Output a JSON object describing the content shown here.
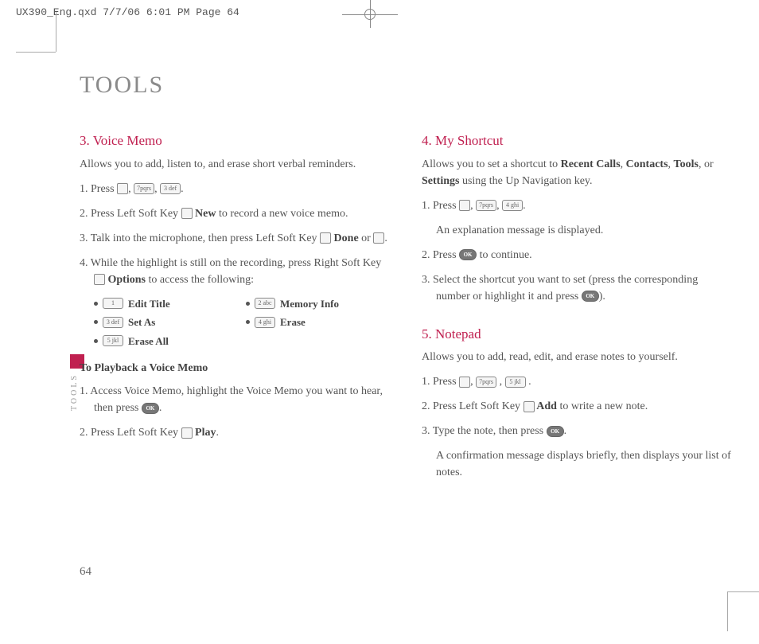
{
  "printHeader": "UX390_Eng.qxd  7/7/06  6:01 PM  Page 64",
  "pageTitle": "TOOLS",
  "sideLabel": "TOOLS",
  "pageNumber": "64",
  "keys": {
    "k7": "7pqrs",
    "k3": "3 def",
    "k4": "4 ghi",
    "k5": "5 jkl",
    "k1": "1",
    "k2": "2 abc",
    "ok": "OK"
  },
  "voiceMemo": {
    "title": "3. Voice Memo",
    "intro": "Allows you to add, listen to, and erase short verbal reminders.",
    "s1a": "1. Press ",
    "s2a": "2. Press Left Soft Key ",
    "s2b": " New",
    "s2c": " to record a new voice memo.",
    "s3a": "3. Talk into the microphone, then press Left Soft Key ",
    "s3b": " Done",
    "s3c": " or ",
    "s4a": "4. While the highlight is still on the recording, press Right Soft Key ",
    "s4b": " Options",
    "s4c": " to access the following:",
    "opt1": "Edit Title",
    "opt2": "Memory Info",
    "opt3": "Set As",
    "opt4": "Erase",
    "opt5": "Erase All",
    "playbackTitle": "To Playback a Voice Memo",
    "p1a": "1. Access Voice Memo, highlight the Voice Memo you want to hear, then press ",
    "p2a": "2. Press Left Soft Key ",
    "p2b": " Play"
  },
  "shortcut": {
    "title": "4. My Shortcut",
    "introA": "Allows you to set a shortcut to ",
    "rc": "Recent Calls",
    "c": "Contacts",
    "t": "Tools",
    "or": ", or ",
    "s": "Settings",
    "introB": " using the Up Navigation key.",
    "s1": "1. Press ",
    "s1b": "An explanation message is displayed.",
    "s2a": "2. Press ",
    "s2b": " to continue.",
    "s3a": "3. Select the shortcut you want to set (press the corresponding number or highlight it and press ",
    "s3b": ")."
  },
  "notepad": {
    "title": "5. Notepad",
    "intro": "Allows you to add, read, edit, and erase notes to yourself.",
    "s1": "1. Press ",
    "s2a": "2. Press Left Soft Key ",
    "s2b": " Add",
    "s2c": " to write a new note.",
    "s3a": "3. Type the note, then press ",
    "s3end": "A confirmation message displays briefly, then displays your list of notes."
  }
}
